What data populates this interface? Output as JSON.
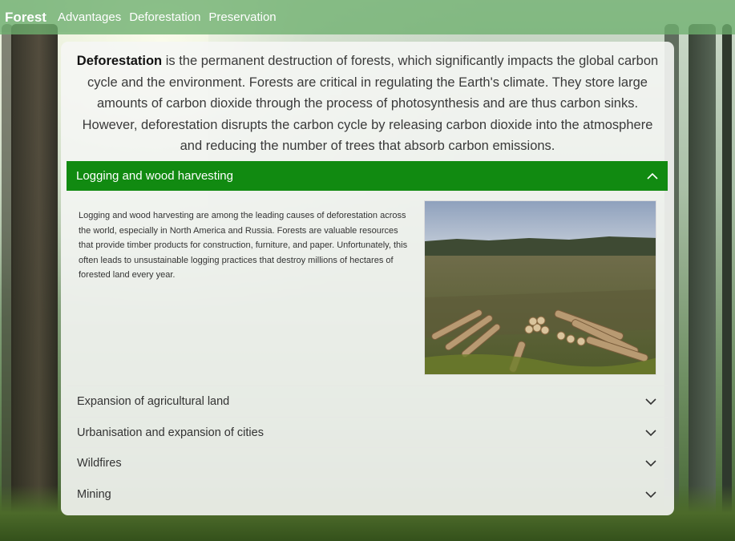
{
  "nav": {
    "brand": "Forest",
    "links": [
      "Advantages",
      "Deforestation",
      "Preservation"
    ]
  },
  "intro": {
    "term": "Deforestation",
    "text": " is the permanent destruction of forests, which significantly impacts the global carbon cycle and the environment. Forests are critical in regulating the Earth's climate. They store large amounts of carbon dioxide through the process of photosynthesis and are thus carbon sinks. However, deforestation disrupts the carbon cycle by releasing carbon dioxide into the atmosphere and reducing the number of trees that absorb carbon emissions."
  },
  "accordion": {
    "open": {
      "title": "Logging and wood harvesting",
      "body": "Logging and wood harvesting are among the leading causes of deforestation across the world, especially in North America and Russia. Forests are valuable resources that provide timber products for construction, furniture, and paper. Unfortunately, this often leads to unsustainable logging practices that destroy millions of hectares of forested land every year."
    },
    "items": [
      "Expansion of agricultural land",
      "Urbanisation and expansion of cities",
      "Wildfires",
      "Mining"
    ]
  },
  "colors": {
    "accent": "#118a11",
    "nav": "#6eb06e"
  },
  "icons": {
    "collapse": "chevron-up-icon",
    "expand": "chevron-down-icon"
  }
}
